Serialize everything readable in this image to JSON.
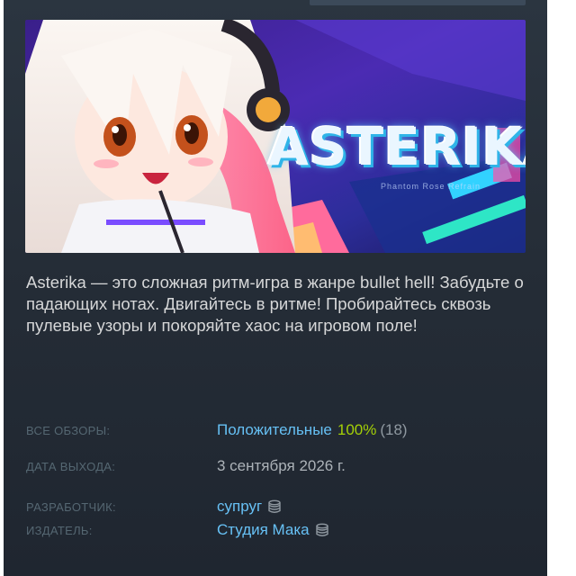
{
  "game": {
    "logo_title": "ASTERIKA",
    "logo_subtitle": "Phantom Rose Refrain",
    "description": "Asterika — это сложная ритм-игра в жанре bullet hell! Забудьте о падающих нотах. Двигайтесь в ритме! Пробирайтесь сквозь пулевые узоры и покоряйте хаос на игровом поле!"
  },
  "details": {
    "reviews_label": "ВСЕ ОБЗОРЫ:",
    "reviews_summary": "Положительные",
    "reviews_percent": "100%",
    "reviews_count": "(18)",
    "release_label": "ДАТА ВЫХОДА:",
    "release_date": "3 сентября 2026 г.",
    "developer_label": "РАЗРАБОТЧИК:",
    "developer_name": "супруг",
    "publisher_label": "ИЗДАТЕЛЬ:",
    "publisher_name": "Студия Мака"
  },
  "icons": {
    "developer_icon": "coins-stack-icon",
    "publisher_icon": "coins-stack-icon"
  },
  "colors": {
    "panel_bg": "#28313b",
    "link": "#67c1f5",
    "positive_percent": "#a4d007",
    "label": "#556772",
    "description_text": "#d6d7d8"
  }
}
